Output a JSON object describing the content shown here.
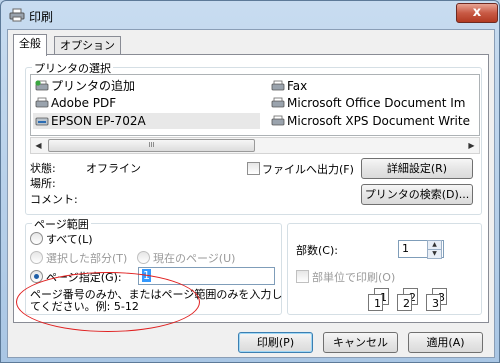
{
  "window": {
    "title": "印刷",
    "close": "x"
  },
  "tabs": [
    {
      "label": "全般"
    },
    {
      "label": "オプション"
    }
  ],
  "printer_group": {
    "label": "プリンタの選択",
    "printers_left": [
      {
        "name": "プリンタの追加",
        "icon": "add-printer-icon"
      },
      {
        "name": "Adobe PDF",
        "icon": "printer-icon"
      },
      {
        "name": "EPSON EP-702A",
        "icon": "epson-printer-icon"
      }
    ],
    "printers_right": [
      {
        "name": "Fax",
        "icon": "fax-icon"
      },
      {
        "name": "Microsoft Office Document Im",
        "icon": "printer-icon"
      },
      {
        "name": "Microsoft XPS Document Write",
        "icon": "printer-icon"
      }
    ],
    "scroll_thumb": "III",
    "status_label": "状態:",
    "status_value": "オフライン",
    "location_label": "場所:",
    "comment_label": "コメント:",
    "print_to_file": "ファイルへ出力(F)",
    "details_button": "詳細設定(R)",
    "find_printer_button": "プリンタの検索(D)..."
  },
  "page_range": {
    "label": "ページ範囲",
    "all": "すべて(L)",
    "selection": "選択した部分(T)",
    "current_page": "現在のページ(U)",
    "pages": "ページ指定(G):",
    "pages_value": "1",
    "hint_line1": "ページ番号のみか、またはページ範囲のみを入力し",
    "hint_line2": "てください。例: 5-12"
  },
  "copies": {
    "label": "部数(C):",
    "value": "1",
    "collate": "部単位で印刷(O)",
    "collate_digits": [
      "1",
      "1",
      "2",
      "2",
      "3",
      "3"
    ]
  },
  "footer": {
    "print_button": "印刷(P)",
    "cancel_button": "キャンセル",
    "apply_button": "適用(A)"
  },
  "colors": {
    "accent": "#3c7fb1",
    "highlight_ellipse": "#e02020",
    "title_gradient": "#bcd3ea",
    "close_button": "#c85a45"
  }
}
